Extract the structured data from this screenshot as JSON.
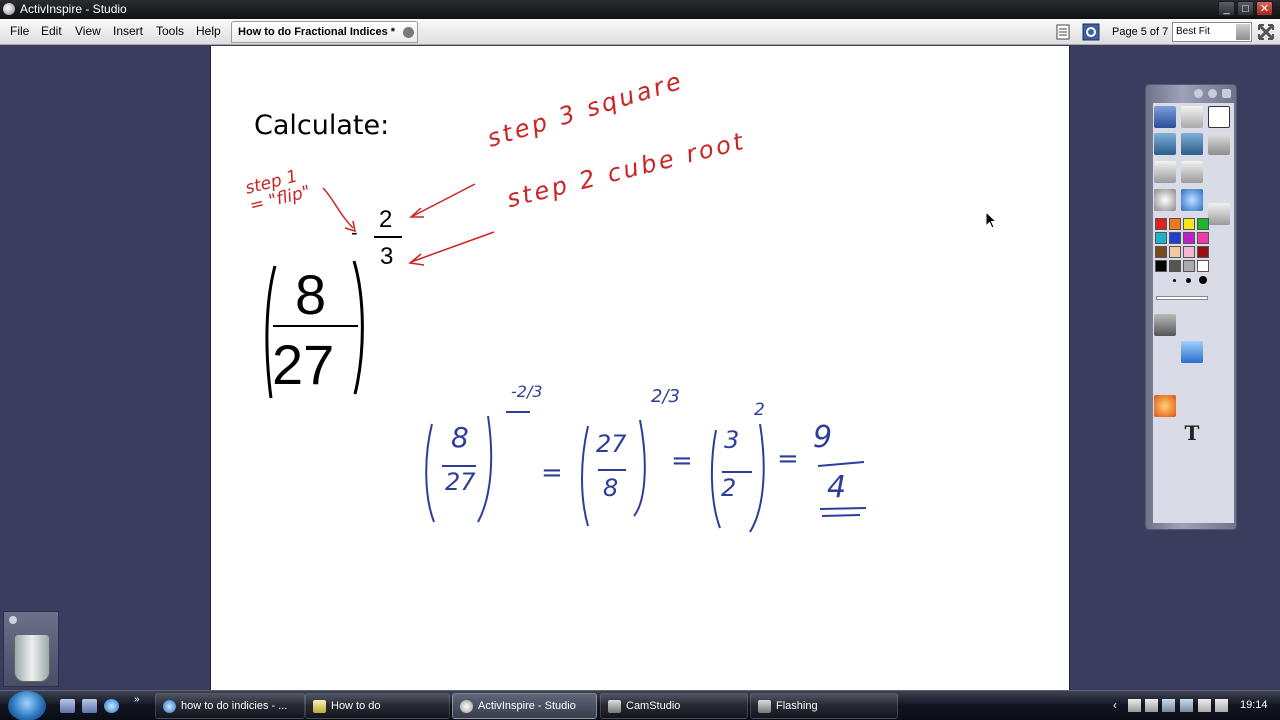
{
  "window": {
    "title": "ActivInspire - Studio"
  },
  "menu": {
    "items": [
      "File",
      "Edit",
      "View",
      "Insert",
      "Tools",
      "Help"
    ]
  },
  "document_tab": {
    "label": "How to do Fractional Indices *"
  },
  "navigation": {
    "page_label": "Page 5 of 7",
    "zoom": "Best Fit"
  },
  "flipchart": {
    "heading": "Calculate:",
    "question": {
      "exponent_sign": "-",
      "exponent_numerator": "2",
      "exponent_denominator": "3",
      "numerator": "8",
      "denominator": "27"
    },
    "annotations": {
      "step1": "step 1 = \"flip\"",
      "step2": "step 2 cube root",
      "step3": "step 3 square"
    },
    "working": {
      "term1": {
        "numerator": "8",
        "denominator": "27",
        "exponent": "-2/3"
      },
      "equals1": "=",
      "term2": {
        "numerator": "27",
        "denominator": "8",
        "exponent": "2/3"
      },
      "equals2": "=",
      "term3": {
        "numerator": "3",
        "denominator": "2",
        "exponent": "2"
      },
      "equals3": "=",
      "answer": {
        "numerator": "9",
        "denominator": "4"
      }
    },
    "colors": {
      "annotation": "#cc2222",
      "working": "#2c3e9a"
    }
  },
  "taskbar": {
    "tasks": [
      "how to do indicies - ...",
      "How to do",
      "ActivInspire - Studio",
      "CamStudio",
      "Flashing"
    ],
    "active_task": "ActivInspire - Studio",
    "clock": "19:14"
  }
}
